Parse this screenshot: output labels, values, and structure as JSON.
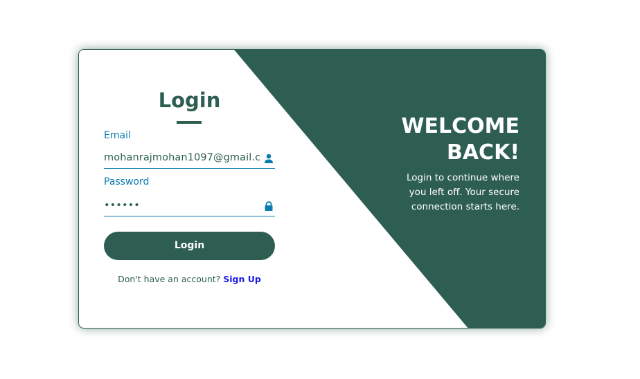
{
  "login": {
    "title": "Login",
    "email_label": "Email",
    "email_value": "mohanrajmohan1097@gmail.c",
    "password_label": "Password",
    "password_value": "••••••",
    "button": "Login",
    "no_account": "Don't have an account?",
    "signup_link": "Sign Up"
  },
  "welcome": {
    "line1": "WELCOME",
    "line2": "BACK!",
    "subtitle": "Login to continue where you left off. Your secure connection starts here."
  },
  "colors": {
    "primary": "#2e5e52",
    "accent": "#0b7bb0",
    "link": "#1a1ae6"
  }
}
